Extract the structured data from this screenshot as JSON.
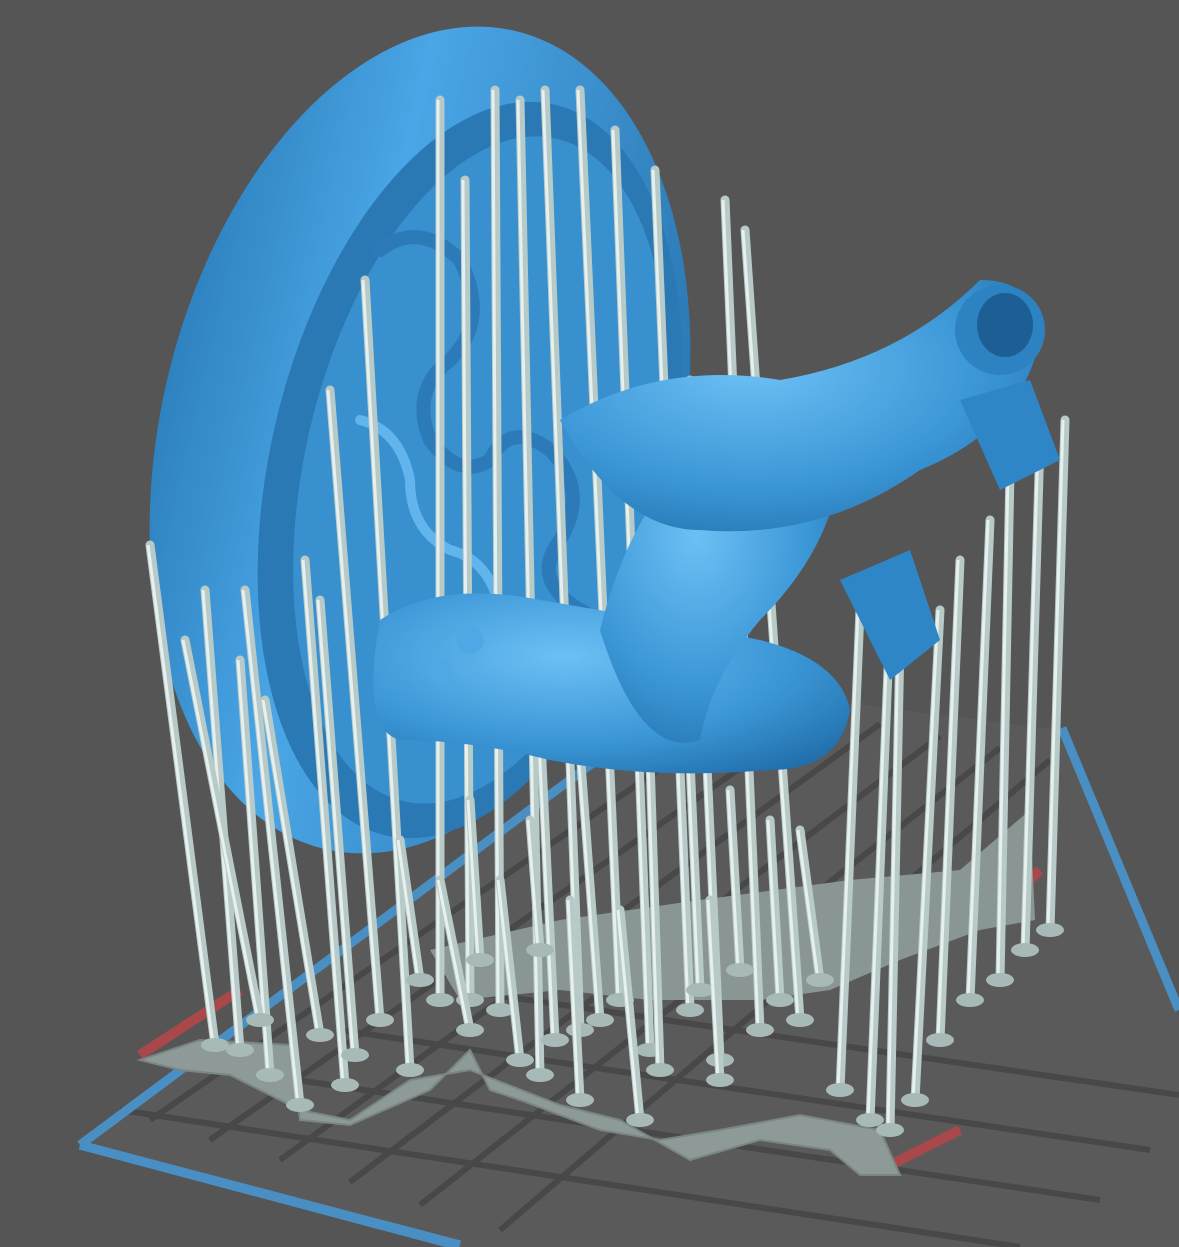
{
  "viewport": {
    "background": "#555555",
    "model_color": "#3d9ad8",
    "support_color": "#b4c6c4",
    "raft_color": "#8e9a98",
    "build_plate_border_color": "#4a8fc4",
    "build_plate_grid_color": "#4a4a4a",
    "axis_marker_color": "#a8484a"
  },
  "scene": {
    "model": "miniature-on-round-base",
    "supports": "generated-support-pillars",
    "build_plate": "grid-plate"
  }
}
